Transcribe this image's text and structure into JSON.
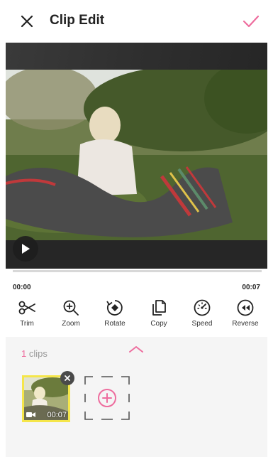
{
  "header": {
    "title": "Clip Edit"
  },
  "player": {
    "current_time": "00:00",
    "duration": "00:07"
  },
  "tools": [
    {
      "label": "Trim",
      "icon": "scissors-icon"
    },
    {
      "label": "Zoom",
      "icon": "zoom-in-icon"
    },
    {
      "label": "Rotate",
      "icon": "rotate-icon"
    },
    {
      "label": "Copy",
      "icon": "copy-icon"
    },
    {
      "label": "Speed",
      "icon": "speed-icon"
    },
    {
      "label": "Reverse",
      "icon": "reverse-icon"
    }
  ],
  "clips": {
    "count": "1",
    "count_label": "clips",
    "items": [
      {
        "duration": "00:07"
      }
    ]
  },
  "colors": {
    "accent": "#ee6d9e",
    "selected_clip_border": "#f5e64a"
  }
}
